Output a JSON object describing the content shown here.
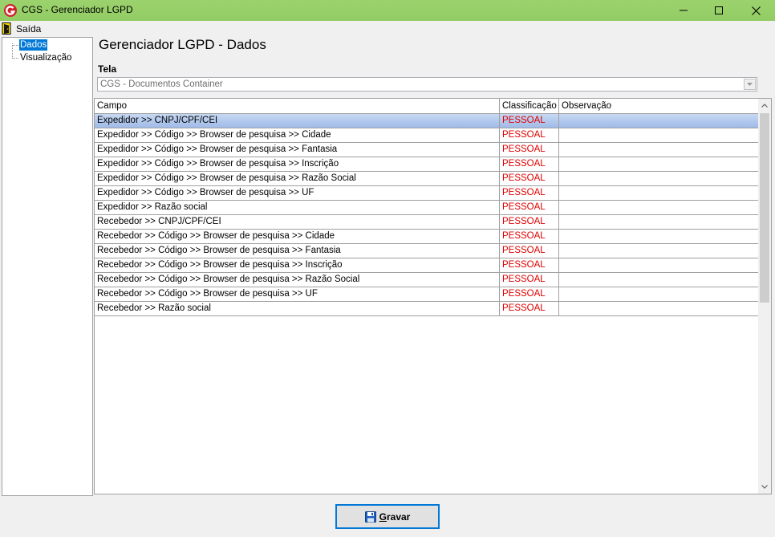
{
  "window": {
    "title": "CGS - Gerenciador LGPD",
    "minimize_icon": "minimize-icon",
    "maximize_icon": "maximize-icon",
    "close_icon": "close-icon"
  },
  "menu": {
    "items": [
      {
        "label": "Saída",
        "icon": "exit-door-icon"
      }
    ]
  },
  "tree": {
    "items": [
      {
        "label": "Dados",
        "selected": true
      },
      {
        "label": "Visualização",
        "selected": false
      }
    ]
  },
  "main": {
    "title": "Gerenciador LGPD - Dados",
    "tela_label": "Tela",
    "tela_value": "CGS - Documentos Container"
  },
  "grid": {
    "columns": [
      "Campo",
      "Classificação",
      "Observação"
    ],
    "rows": [
      {
        "campo": "Expedidor >> CNPJ/CPF/CEI",
        "classificacao": "PESSOAL",
        "observacao": ""
      },
      {
        "campo": "Expedidor >> Código >> Browser de pesquisa >> Cidade",
        "classificacao": "PESSOAL",
        "observacao": ""
      },
      {
        "campo": "Expedidor >> Código >> Browser de pesquisa >> Fantasia",
        "classificacao": "PESSOAL",
        "observacao": ""
      },
      {
        "campo": "Expedidor >> Código >> Browser de pesquisa >> Inscrição",
        "classificacao": "PESSOAL",
        "observacao": ""
      },
      {
        "campo": "Expedidor >> Código >> Browser de pesquisa >> Razão Social",
        "classificacao": "PESSOAL",
        "observacao": ""
      },
      {
        "campo": "Expedidor >> Código >> Browser de pesquisa >> UF",
        "classificacao": "PESSOAL",
        "observacao": ""
      },
      {
        "campo": "Expedidor >> Razão social",
        "classificacao": "PESSOAL",
        "observacao": ""
      },
      {
        "campo": "Recebedor >> CNPJ/CPF/CEI",
        "classificacao": "PESSOAL",
        "observacao": ""
      },
      {
        "campo": "Recebedor >> Código >> Browser de pesquisa >> Cidade",
        "classificacao": "PESSOAL",
        "observacao": ""
      },
      {
        "campo": "Recebedor >> Código >> Browser de pesquisa >> Fantasia",
        "classificacao": "PESSOAL",
        "observacao": ""
      },
      {
        "campo": "Recebedor >> Código >> Browser de pesquisa >> Inscrição",
        "classificacao": "PESSOAL",
        "observacao": ""
      },
      {
        "campo": "Recebedor >> Código >> Browser de pesquisa >> Razão Social",
        "classificacao": "PESSOAL",
        "observacao": ""
      },
      {
        "campo": "Recebedor >> Código >> Browser de pesquisa >> UF",
        "classificacao": "PESSOAL",
        "observacao": ""
      },
      {
        "campo": "Recebedor >> Razão social",
        "classificacao": "PESSOAL",
        "observacao": ""
      }
    ],
    "selected_row": 0
  },
  "footer": {
    "save_first": "G",
    "save_rest": "ravar",
    "save_icon": "floppy-disk-icon"
  },
  "colors": {
    "title_bar": "#96cf68",
    "selection": "#0078d7",
    "classification_text": "#e00000"
  }
}
